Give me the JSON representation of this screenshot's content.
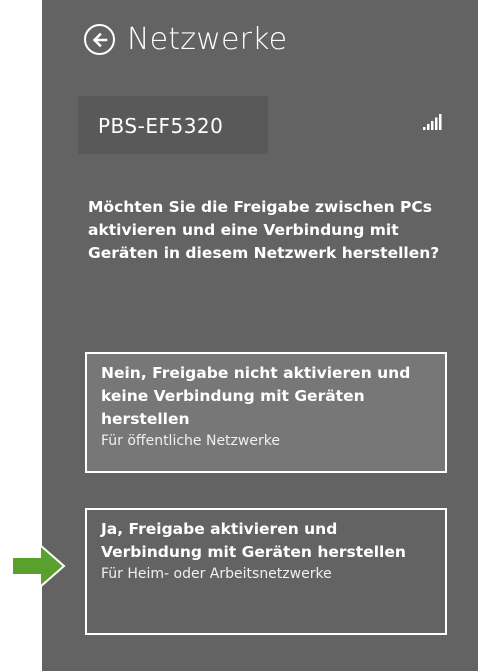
{
  "header": {
    "title": "Netzwerke",
    "back_icon": "back-arrow-circle-icon"
  },
  "network": {
    "name": "PBS-EF5320",
    "signal_icon": "signal-strength-icon"
  },
  "question": "Möchten Sie die Freigabe zwischen PCs aktivieren und eine Verbindung mit Geräten in diesem Netzwerk herstellen?",
  "options": [
    {
      "title": "Nein, Freigabe nicht aktivieren und keine Verbindung mit Geräten herstellen",
      "subtitle": "Für öffentliche Netzwerke"
    },
    {
      "title": "Ja, Freigabe aktivieren und Verbindung mit Geräten herstellen",
      "subtitle": "Für Heim- oder Arbeitsnetzwerke"
    }
  ],
  "colors": {
    "panel": "#636363",
    "highlight_option": "#777777",
    "pointer_arrow": "#5aa02c"
  }
}
